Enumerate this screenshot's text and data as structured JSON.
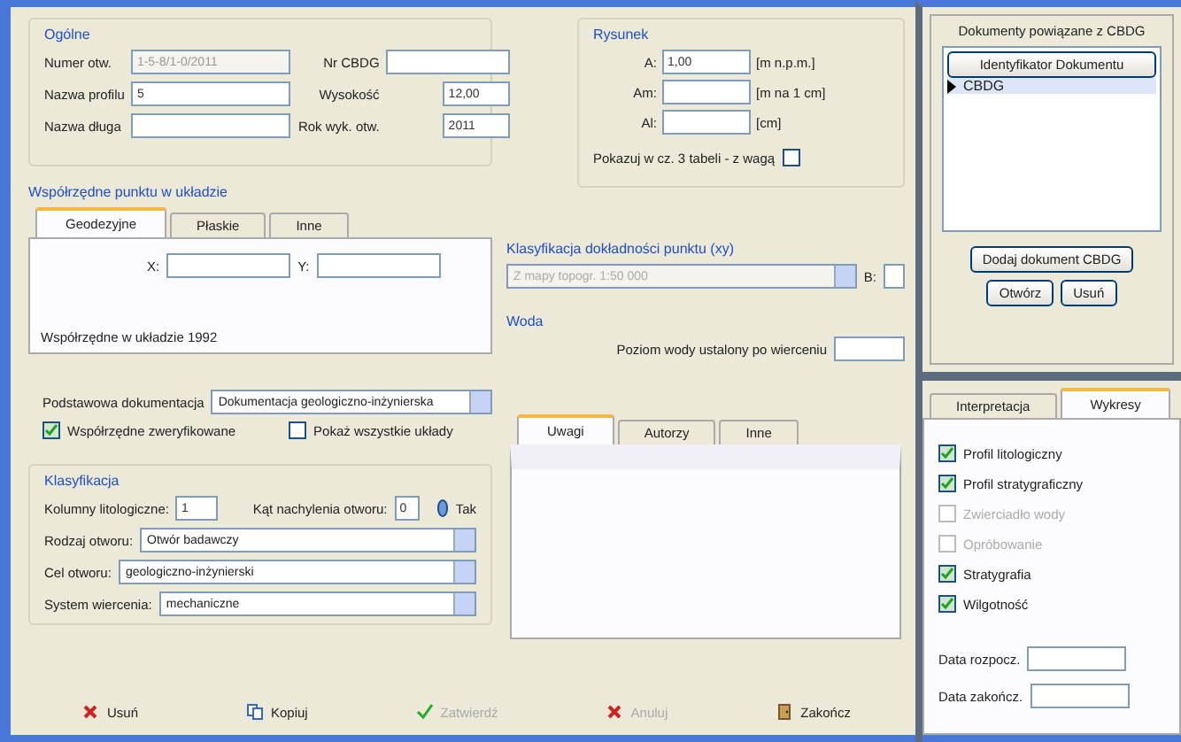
{
  "general": {
    "title": "Ogólne",
    "fields": [
      {
        "label": "Numer otw.",
        "value": "1-5-8/1-0/2011",
        "disabled": true
      },
      {
        "label": "Nazwa profilu",
        "value": "5",
        "disabled": false
      },
      {
        "label": "Nazwa długa",
        "disabled": false
      },
      {
        "label": "Nr CBDG",
        "disabled": false
      },
      {
        "label": "Wysokość",
        "value": "12,00",
        "disabled": false
      },
      {
        "label": "Rok wyk. otw.",
        "value": "2011",
        "disabled": false
      }
    ]
  },
  "drawing": {
    "title": "Rysunek",
    "rows": [
      {
        "label": "A:",
        "value": "1,00",
        "unit": "[m n.p.m.]"
      },
      {
        "label": "Am:",
        "unit": "[m na 1 cm]"
      },
      {
        "label": "Al:",
        "unit": "[cm]"
      }
    ],
    "checkbox": {
      "label": "Pokazuj w cz. 3 tabeli - z wagą",
      "checked": false
    }
  },
  "coordinates": {
    "title": "Współrzędne punktu w układzie",
    "tabs": [
      {
        "label": "Geodezyjne",
        "selected": true
      },
      {
        "label": "Płaskie",
        "selected": false
      },
      {
        "label": "Inne",
        "selected": false
      }
    ],
    "x_label": "X:",
    "y_label": "Y:",
    "note": "Współrzędne w układzie 1992"
  },
  "accuracy": {
    "title": "Klasyfikacja dokładności punktu (xy)",
    "value": "Z mapy topogr. 1:50 000",
    "disabled": true,
    "extra_label": "B:"
  },
  "water": {
    "title": "Woda",
    "label": "Poziom wody ustalony po wierceniu"
  },
  "documentation": {
    "label": "Podstawowa dokumentacja",
    "value": "Dokumentacja geologiczno-inżynierska",
    "checkboxes": [
      {
        "label": "Współrzędne zweryfikowane",
        "checked": true
      },
      {
        "label": "Pokaż wszystkie układy",
        "checked": false
      }
    ]
  },
  "notes": {
    "tabs": [
      {
        "label": "Uwagi",
        "selected": true
      },
      {
        "label": "Autorzy",
        "selected": false
      },
      {
        "label": "Inne",
        "selected": false
      }
    ]
  },
  "classification": {
    "title": "Klasyfikacja",
    "columns_label": "Kolumny litologiczne:",
    "columns_value": "1",
    "angle_label": "Kąt nachylenia otworu:",
    "angle_value": "0",
    "radio": {
      "label": "Tak",
      "selected": true
    },
    "selects": [
      {
        "label": "Rodzaj otworu:",
        "value": "Otwór badawczy"
      },
      {
        "label": "Cel otworu:",
        "value": "geologiczno-inżynierski"
      },
      {
        "label": "System wiercenia:",
        "value": "mechaniczne"
      }
    ]
  },
  "buttons": [
    {
      "label": "Usuń",
      "kind": "delete",
      "disabled": false
    },
    {
      "label": "Kopiuj",
      "kind": "copy",
      "disabled": false
    },
    {
      "label": "Zatwierdź",
      "kind": "confirm",
      "disabled": true
    },
    {
      "label": "Anuluj",
      "kind": "cancel",
      "disabled": true
    },
    {
      "label": "Zakończ",
      "kind": "exit",
      "disabled": false
    }
  ],
  "documents": {
    "title": "Dokumenty powiązane z CBDG",
    "column": "Identyfikator Dokumentu",
    "rows": [
      {
        "text": "CBDG",
        "selected": true
      }
    ],
    "buttons": [
      "Dodaj dokument CBDG",
      "Otwórz",
      "Usuń"
    ]
  },
  "charts": {
    "tabs": [
      {
        "label": "Interpretacja",
        "selected": false
      },
      {
        "label": "Wykresy",
        "selected": true
      }
    ],
    "checks": [
      {
        "label": "Profil litologiczny",
        "checked": true,
        "disabled": false
      },
      {
        "label": "Profil stratygraficzny",
        "checked": true,
        "disabled": false
      },
      {
        "label": "Zwierciadło wody",
        "checked": false,
        "disabled": true
      },
      {
        "label": "Opróbowanie",
        "checked": false,
        "disabled": true
      },
      {
        "label": "Stratygrafia",
        "checked": true,
        "disabled": false
      },
      {
        "label": "Wilgotność",
        "checked": true,
        "disabled": false
      }
    ],
    "dates": [
      {
        "label": "Data rozpocz."
      },
      {
        "label": "Data zakończ."
      }
    ]
  }
}
